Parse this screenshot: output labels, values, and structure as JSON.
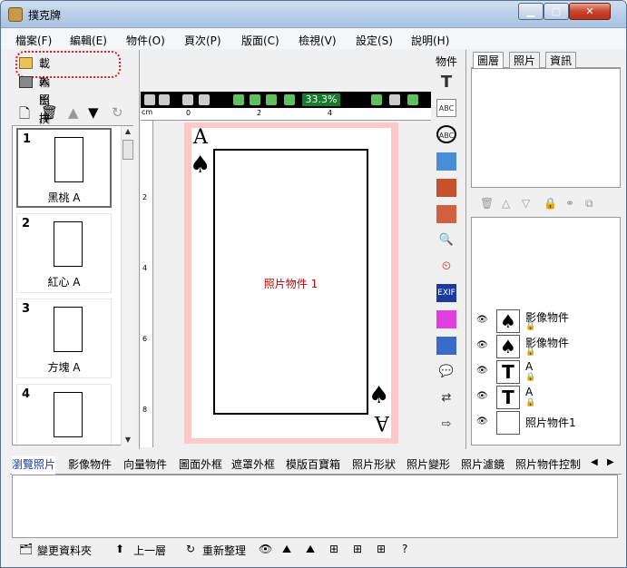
{
  "window": {
    "title": "撲克牌"
  },
  "menu": [
    "檔案(F)",
    "編輯(E)",
    "物件(O)",
    "頁次(P)",
    "版面(C)",
    "檢視(V)",
    "設定(S)",
    "說明(H)"
  ],
  "file_actions": {
    "load_photo": "載入照片",
    "export": "輸出撲克牌"
  },
  "thumbnails": [
    {
      "num": "1",
      "label": "黑桃 A"
    },
    {
      "num": "2",
      "label": "紅心 A"
    },
    {
      "num": "3",
      "label": "方塊 A"
    },
    {
      "num": "4",
      "label": ""
    }
  ],
  "canvas": {
    "zoom": "33.3%",
    "ruler_unit": "cm",
    "ruler_h": [
      "0",
      "2",
      "4"
    ],
    "ruler_v": [
      "2",
      "4",
      "6",
      "8"
    ],
    "photo_label": "照片物件 1",
    "card_letter": "A"
  },
  "object_bar": {
    "title": "物件"
  },
  "right_tabs": [
    "圖層",
    "照片",
    "資訊"
  ],
  "layers": [
    {
      "icon": "♠",
      "name": "影像物件"
    },
    {
      "icon": "♠",
      "name": "影像物件"
    },
    {
      "icon": "T",
      "name": "A"
    },
    {
      "icon": "T",
      "name": "A"
    },
    {
      "icon": "",
      "name": "照片物件1"
    }
  ],
  "bottom_tabs": [
    "瀏覽照片",
    "影像物件",
    "向量物件",
    "圖面外框",
    "遮罩外框",
    "模版百寶箱",
    "照片形狀",
    "照片變形",
    "照片濾鏡",
    "照片物件控制"
  ],
  "statusbar": {
    "change_folder": "變更資料夾",
    "up_level": "上一層",
    "refresh": "重新整理"
  }
}
